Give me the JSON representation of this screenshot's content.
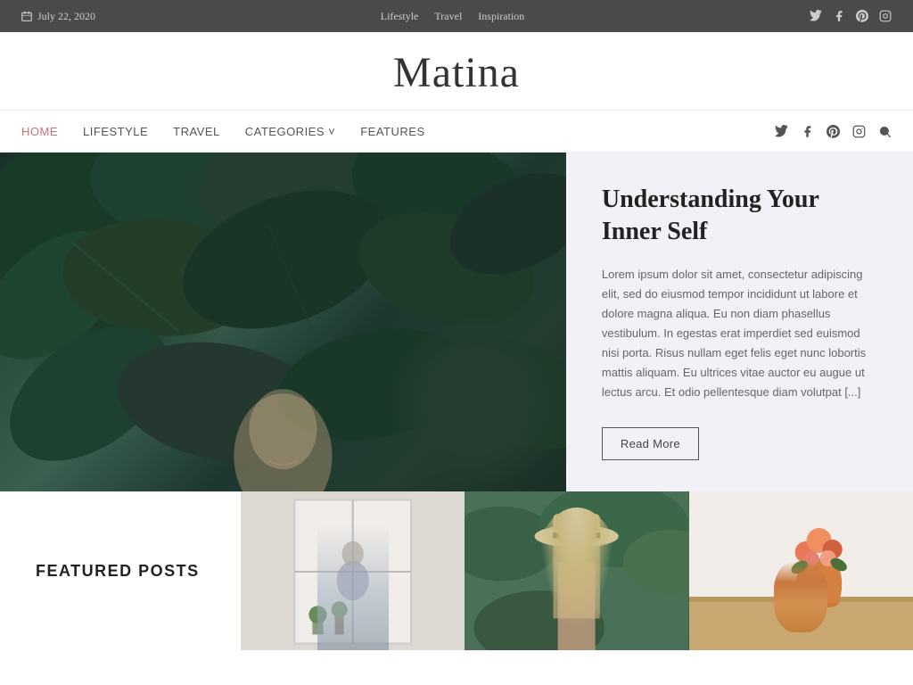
{
  "topbar": {
    "date": "July 22, 2020",
    "nav_links": [
      "Lifestyle",
      "Travel",
      "Inspiration"
    ]
  },
  "logo": {
    "text": "Matina"
  },
  "nav": {
    "links": [
      {
        "label": "HOME",
        "active": true
      },
      {
        "label": "LIFESTYLE",
        "active": false
      },
      {
        "label": "TRAVEL",
        "active": false
      },
      {
        "label": "CATEGORIES ˅",
        "active": false,
        "dropdown": true
      },
      {
        "label": "FEATURES",
        "active": false
      }
    ]
  },
  "hero": {
    "title": "Understanding Your Inner Self",
    "excerpt": "Lorem ipsum dolor sit amet, consectetur adipiscing elit, sed do eiusmod tempor incididunt ut labore et dolore magna aliqua. Eu non diam phasellus vestibulum. In egestas erat imperdiet sed euismod nisi porta. Risus nullam eget felis eget nunc lobortis mattis aliquam. Eu ultrices vitae auctor eu augue ut lectus arcu. Et odio pellentesque diam volutpat [...]",
    "read_more": "Read More"
  },
  "featured": {
    "label": "FEATURED POSTS"
  }
}
